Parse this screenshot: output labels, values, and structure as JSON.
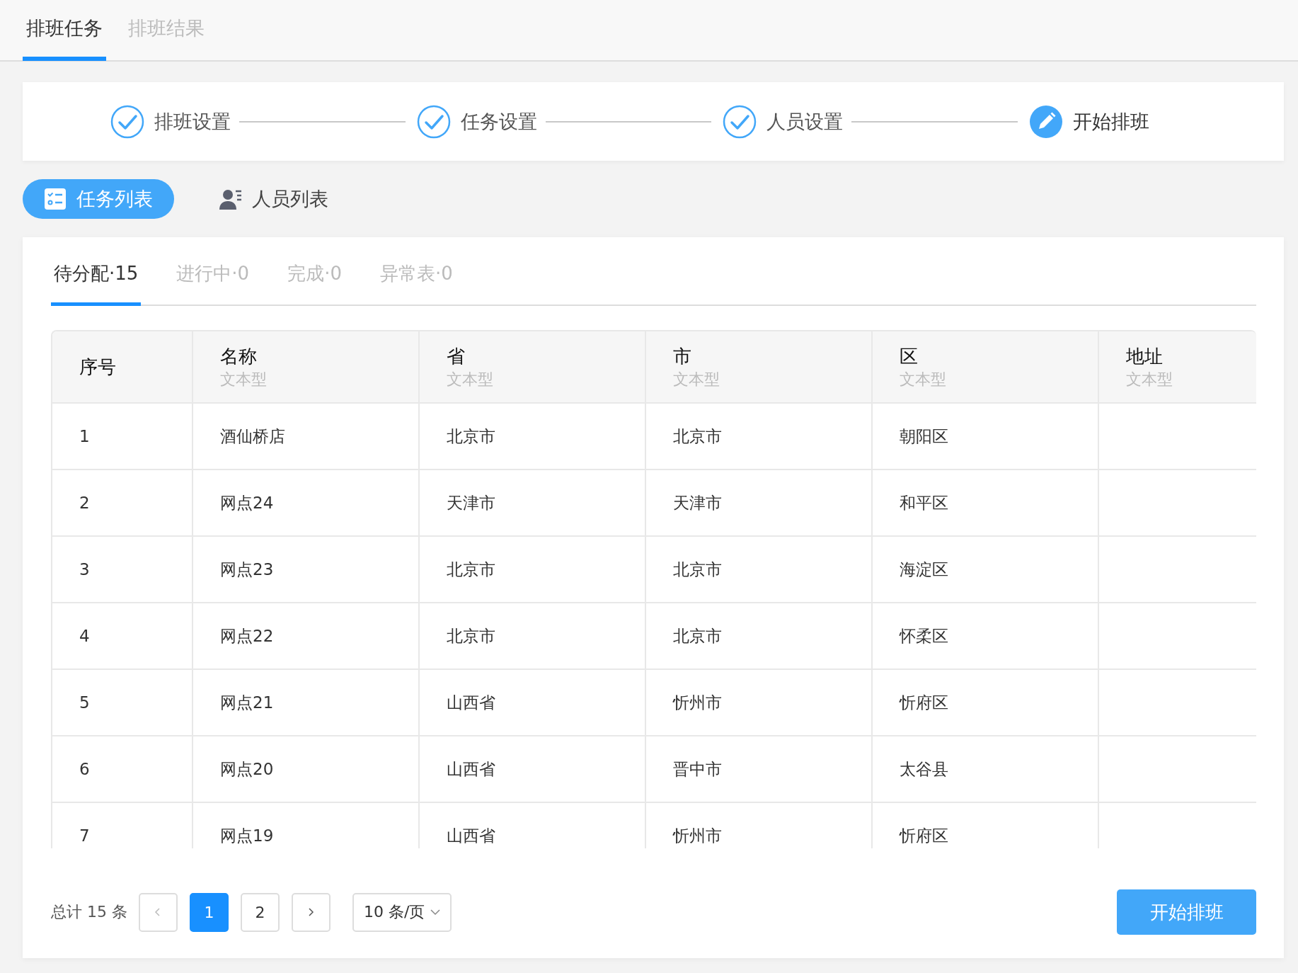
{
  "top_tabs": [
    {
      "label": "排班任务",
      "selected": true
    },
    {
      "label": "排班结果",
      "selected": false
    }
  ],
  "steps": [
    {
      "label": "排班设置",
      "completed": true
    },
    {
      "label": "任务设置",
      "completed": true
    },
    {
      "label": "人员设置",
      "completed": true
    },
    {
      "label": "开始排班",
      "completed": false
    }
  ],
  "view_toggle": [
    {
      "label": "任务列表",
      "kind": "tasks",
      "selected": true
    },
    {
      "label": "人员列表",
      "kind": "people",
      "selected": false
    }
  ],
  "status_tabs": [
    {
      "label": "待分配·15",
      "selected": true
    },
    {
      "label": "进行中·0",
      "selected": false
    },
    {
      "label": "完成·0",
      "selected": false
    },
    {
      "label": "异常表·0",
      "selected": false
    }
  ],
  "table": {
    "columns": [
      {
        "title": "序号"
      },
      {
        "title": "名称",
        "subtitle": "文本型"
      },
      {
        "title": "省",
        "subtitle": "文本型"
      },
      {
        "title": "市",
        "subtitle": "文本型"
      },
      {
        "title": "区",
        "subtitle": "文本型"
      },
      {
        "title": "地址",
        "subtitle": "文本型"
      }
    ],
    "rows": [
      [
        "1",
        "酒仙桥店",
        "北京市",
        "北京市",
        "朝阳区"
      ],
      [
        "2",
        "网点24",
        "天津市",
        "天津市",
        "和平区"
      ],
      [
        "3",
        "网点23",
        "北京市",
        "北京市",
        "海淀区"
      ],
      [
        "4",
        "网点22",
        "北京市",
        "北京市",
        "怀柔区"
      ],
      [
        "5",
        "网点21",
        "山西省",
        "忻州市",
        "忻府区"
      ],
      [
        "6",
        "网点20",
        "山西省",
        "晋中市",
        "太谷县"
      ],
      [
        "7",
        "网点19",
        "山西省",
        "忻州市",
        "忻府区"
      ]
    ]
  },
  "pagination": {
    "total": "总计 15 条",
    "pages": [
      {
        "label": "1",
        "selected": true
      },
      {
        "label": "2",
        "selected": false
      }
    ],
    "page_size": "10 条/页"
  },
  "start_button": "开始排班"
}
